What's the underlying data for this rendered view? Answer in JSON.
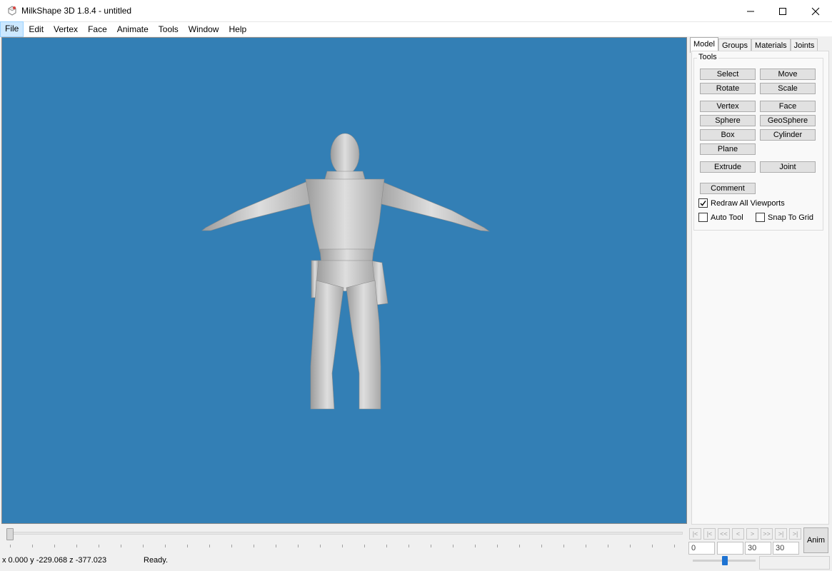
{
  "window": {
    "title": "MilkShape 3D 1.8.4 - untitled"
  },
  "menu": [
    "File",
    "Edit",
    "Vertex",
    "Face",
    "Animate",
    "Tools",
    "Window",
    "Help"
  ],
  "tabs": [
    "Model",
    "Groups",
    "Materials",
    "Joints"
  ],
  "tools": {
    "legend": "Tools",
    "select": "Select",
    "move": "Move",
    "rotate": "Rotate",
    "scale": "Scale",
    "vertex": "Vertex",
    "face": "Face",
    "sphere": "Sphere",
    "geosphere": "GeoSphere",
    "box": "Box",
    "cylinder": "Cylinder",
    "plane": "Plane",
    "extrude": "Extrude",
    "joint": "Joint",
    "comment": "Comment",
    "redraw_all": "Redraw All Viewports",
    "redraw_all_checked": true,
    "auto_tool": "Auto Tool",
    "auto_tool_checked": false,
    "snap_to_grid": "Snap To Grid",
    "snap_to_grid_checked": false
  },
  "animation": {
    "current_frame": "0",
    "frame_box_2": "",
    "frame_box_3": "30",
    "total_frames": "30",
    "anim_button": "Anim"
  },
  "status": {
    "coords": "x 0.000 y -229.068 z -377.023",
    "message": "Ready."
  },
  "colors": {
    "viewport_bg": "#337fb5",
    "model": "#c9c9c9"
  }
}
